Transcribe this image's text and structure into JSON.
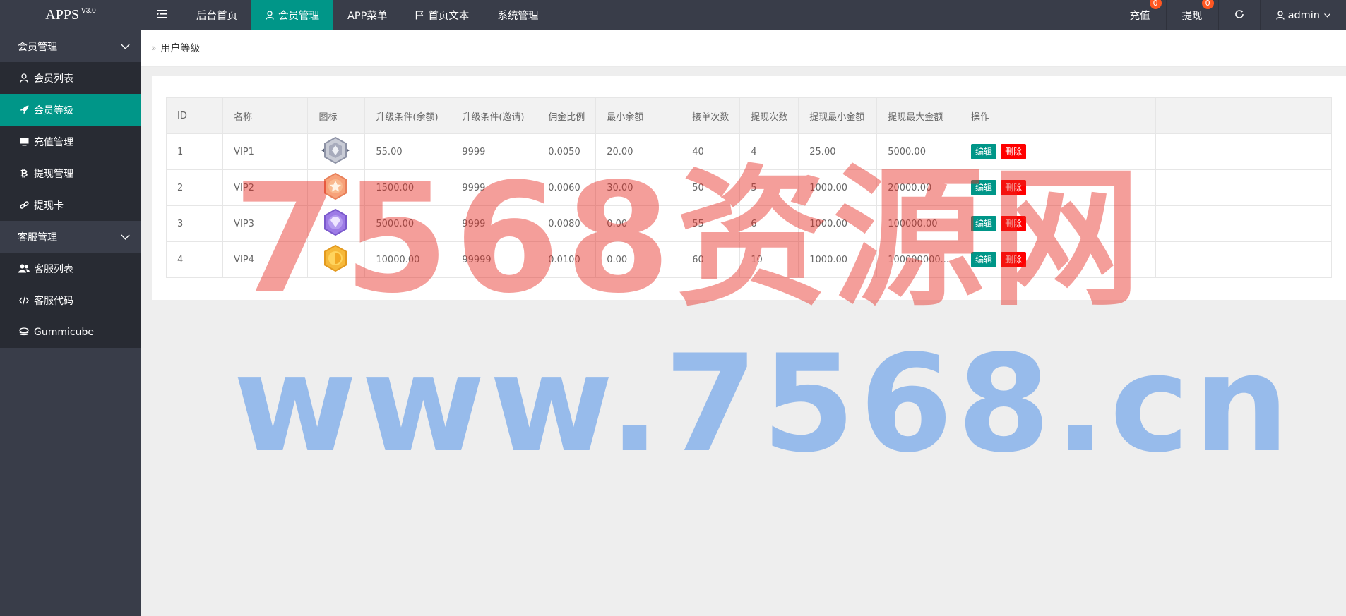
{
  "app": {
    "logo": "APPS",
    "version": "V3.0"
  },
  "topnav": {
    "items": [
      {
        "label": "后台首页"
      },
      {
        "label": "会员管理"
      },
      {
        "label": "APP菜单"
      },
      {
        "label": "首页文本"
      },
      {
        "label": "系统管理"
      }
    ],
    "recharge": {
      "label": "充值",
      "count": "0"
    },
    "withdraw": {
      "label": "提现",
      "count": "0"
    },
    "user": "admin"
  },
  "sidebar": {
    "groups": [
      {
        "label": "会员管理",
        "items": [
          {
            "label": "会员列表",
            "icon": "user-icon"
          },
          {
            "label": "会员等级",
            "icon": "rocket-icon"
          },
          {
            "label": "充值管理",
            "icon": "monitor-icon"
          },
          {
            "label": "提现管理",
            "icon": "bitcoin-icon"
          },
          {
            "label": "提现卡",
            "icon": "link-icon"
          }
        ]
      },
      {
        "label": "客服管理",
        "items": [
          {
            "label": "客服列表",
            "icon": "users-icon"
          },
          {
            "label": "客服代码",
            "icon": "code-icon"
          },
          {
            "label": "Gummicube",
            "icon": "layers-icon"
          }
        ]
      }
    ]
  },
  "breadcrumb": "用户等级",
  "table": {
    "headers": [
      "ID",
      "名称",
      "图标",
      "升级条件(余额)",
      "升级条件(邀请)",
      "佣金比例",
      "最小余额",
      "接单次数",
      "提现次数",
      "提现最小金额",
      "提现最大金额",
      "操作"
    ],
    "rows": [
      {
        "id": "1",
        "name": "VIP1",
        "icon": "silver-medal-icon",
        "balance": "55.00",
        "invite": "9999",
        "ratio": "0.0050",
        "min_balance": "20.00",
        "orders": "40",
        "withdraws": "4",
        "wd_min": "25.00",
        "wd_max": "5000.00"
      },
      {
        "id": "2",
        "name": "VIP2",
        "icon": "bronze-medal-icon",
        "balance": "1500.00",
        "invite": "9999",
        "ratio": "0.0060",
        "min_balance": "30.00",
        "orders": "50",
        "withdraws": "5",
        "wd_min": "1000.00",
        "wd_max": "20000.00"
      },
      {
        "id": "3",
        "name": "VIP3",
        "icon": "purple-medal-icon",
        "balance": "5000.00",
        "invite": "9999",
        "ratio": "0.0080",
        "min_balance": "0.00",
        "orders": "55",
        "withdraws": "6",
        "wd_min": "1000.00",
        "wd_max": "100000.00"
      },
      {
        "id": "4",
        "name": "VIP4",
        "icon": "gold-medal-icon",
        "balance": "10000.00",
        "invite": "99999",
        "ratio": "0.0100",
        "min_balance": "0.00",
        "orders": "60",
        "withdraws": "10",
        "wd_min": "1000.00",
        "wd_max": "100000000..."
      }
    ],
    "edit_label": "编辑",
    "delete_label": "删除"
  },
  "watermark": {
    "line1": "7568资源网",
    "line2": "www.7568.cn"
  },
  "colors": {
    "accent": "#009688",
    "topbar": "#393d49",
    "sub_bg": "#282b33",
    "danger": "#ff0000",
    "badge": "#ff5722"
  }
}
